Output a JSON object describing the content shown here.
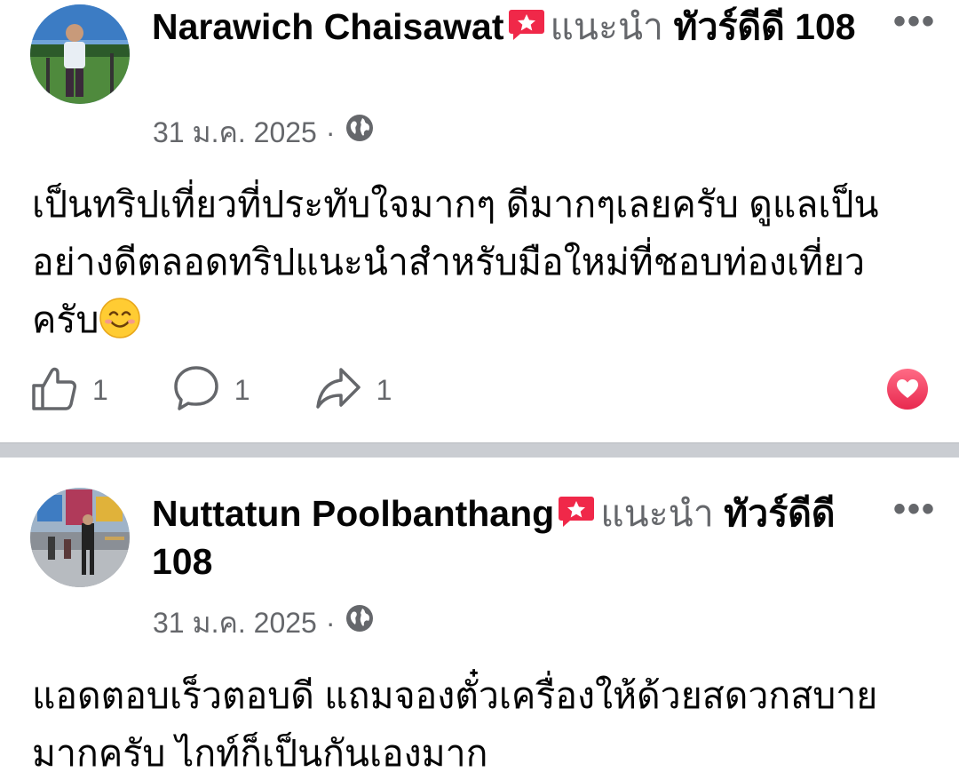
{
  "reviews": [
    {
      "author": "Narawich Chaisawat",
      "recommend_label": "แนะนำ",
      "page_name": "ทัวร์ดีดี 108",
      "date": "31 ม.ค. 2025",
      "separator": "·",
      "audience_icon": "globe-icon",
      "text": "เป็นทริปเที่ยวที่ประทับใจมากๆ  ดีมากๆเลยครับ ดูแลเป็นอย่างดีตลอดทริปแนะนำสำหรับมือใหม่ที่ชอบท่องเที่ยวครับ",
      "emoji": "smiling-face-icon",
      "likes": "1",
      "comments": "1",
      "shares": "1",
      "reaction_icon": "heart-icon",
      "more_label": "•••"
    },
    {
      "author": "Nuttatun Poolbanthang",
      "recommend_label": "แนะนำ",
      "page_name": "ทัวร์ดีดี 108",
      "date": "31 ม.ค. 2025",
      "separator": "·",
      "audience_icon": "globe-icon",
      "text": "แอดตอบเร็วตอบดี แถมจองตั๋วเครื่องให้ด้วยสดวกสบายมากครับ ไกท์ก็เป็นกันเองมาก",
      "more_label": "•••"
    }
  ],
  "colors": {
    "muted": "#65676b",
    "badge": "#f02849",
    "separator": "#cacdd2"
  }
}
